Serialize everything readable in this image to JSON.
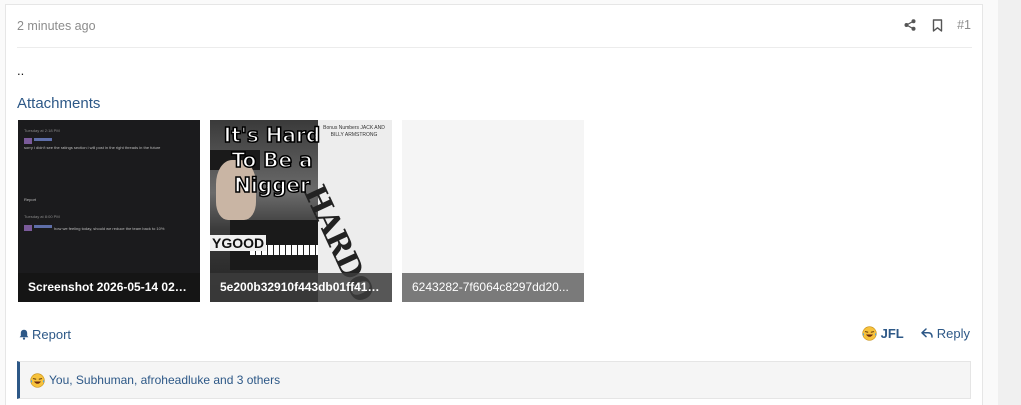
{
  "post": {
    "date": "2 minutes ago",
    "number": "#1",
    "body": "..",
    "share_icon": "share-icon",
    "bookmark_icon": "bookmark-icon"
  },
  "attachments": {
    "title": "Attachments",
    "items": [
      {
        "caption": "Screenshot 2026-05-14 023..."
      },
      {
        "caption": "5e200b32910f443db01ff41b..."
      },
      {
        "caption": "6243282-7f6064c8297dd20..."
      }
    ],
    "screenshot_text": {
      "time1": "Tuesday at 2:18 PM",
      "msg1": "sorry i didn't see the ratings section i will post in the right threads in the future",
      "report": "Report",
      "time2": "Tuesday at 8:00 PM",
      "msg2": "how we feeling today, should we reduce the team back to 10%"
    },
    "meme_text": {
      "top": "It's Hard To Be a Nigger",
      "lyric": "YGOOD",
      "side_header": "Bonus Numbers JACK AND BILLY ARMSTRONG",
      "side_title": "HARDO"
    }
  },
  "footer": {
    "report_label": "Report",
    "reaction_label": "JFL",
    "reply_label": "Reply"
  },
  "reactions": {
    "text": "You, Subhuman, afroheadluke and 3 others"
  },
  "colors": {
    "link": "#2d5887",
    "muted": "#8c8c8c",
    "caption_bg": "#3c3c3c"
  }
}
